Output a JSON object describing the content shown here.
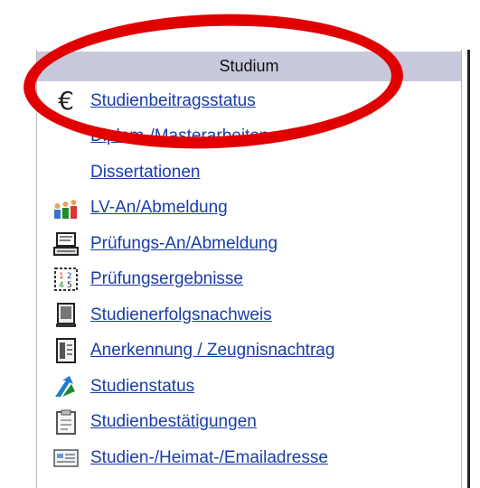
{
  "sidebar": {
    "section_title": "Studium",
    "items": [
      {
        "label": "Studienbeitragsstatus",
        "icon": "euro-icon"
      },
      {
        "label": "Diplom-/Masterarbeiten",
        "icon": ""
      },
      {
        "label": "Dissertationen",
        "icon": ""
      },
      {
        "label": "LV-An/Abmeldung",
        "icon": "people-icon"
      },
      {
        "label": "Prüfungs-An/Abmeldung",
        "icon": "exam-computer-icon"
      },
      {
        "label": "Prüfungsergebnisse",
        "icon": "results-grid-icon"
      },
      {
        "label": "Studienerfolgsnachweis",
        "icon": "document-stack-icon"
      },
      {
        "label": "Anerkennung / Zeugnisnachtrag",
        "icon": "certificate-icon"
      },
      {
        "label": "Studienstatus",
        "icon": "status-arrow-icon"
      },
      {
        "label": "Studienbestätigungen",
        "icon": "clipboard-icon"
      },
      {
        "label": "Studien-/Heimat-/Emailadresse",
        "icon": "address-card-icon"
      }
    ]
  },
  "colors": {
    "header_bg": "#c9c9dd",
    "link": "#1a3da8",
    "highlight": "#e00000"
  }
}
